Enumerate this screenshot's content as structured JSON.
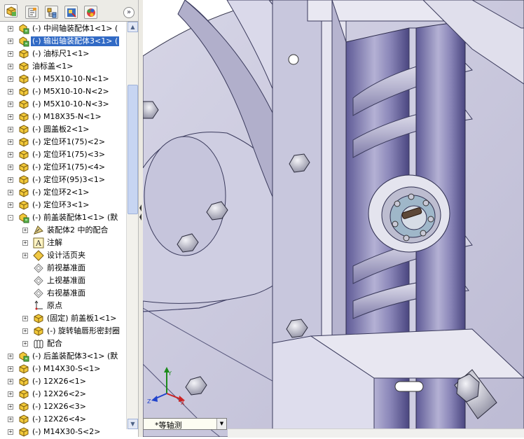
{
  "view_orientation": "*等轴测",
  "tree": [
    {
      "label": "(-) 中间轴装配体1<1> (",
      "expander": "+",
      "indent": 0,
      "icon": "assembly"
    },
    {
      "label": "(-) 输出轴装配体3<1> (",
      "expander": "+",
      "indent": 0,
      "icon": "assembly",
      "selected": true
    },
    {
      "label": "(-) 油标尺1<1>",
      "expander": "+",
      "indent": 0,
      "icon": "part"
    },
    {
      "label": "油标盖<1>",
      "expander": "+",
      "indent": 0,
      "icon": "part"
    },
    {
      "label": "(-) M5X10-10-N<1>",
      "expander": "+",
      "indent": 0,
      "icon": "part"
    },
    {
      "label": "(-) M5X10-10-N<2>",
      "expander": "+",
      "indent": 0,
      "icon": "part"
    },
    {
      "label": "(-) M5X10-10-N<3>",
      "expander": "+",
      "indent": 0,
      "icon": "part"
    },
    {
      "label": "(-) M18X35-N<1>",
      "expander": "+",
      "indent": 0,
      "icon": "part"
    },
    {
      "label": "(-) 圆盖板2<1>",
      "expander": "+",
      "indent": 0,
      "icon": "part"
    },
    {
      "label": "(-) 定位环1(75)<2>",
      "expander": "+",
      "indent": 0,
      "icon": "part"
    },
    {
      "label": "(-) 定位环1(75)<3>",
      "expander": "+",
      "indent": 0,
      "icon": "part"
    },
    {
      "label": "(-) 定位环1(75)<4>",
      "expander": "+",
      "indent": 0,
      "icon": "part"
    },
    {
      "label": "(-) 定位环(95)3<1>",
      "expander": "+",
      "indent": 0,
      "icon": "part"
    },
    {
      "label": "(-) 定位环2<1>",
      "expander": "+",
      "indent": 0,
      "icon": "part"
    },
    {
      "label": "(-) 定位环3<1>",
      "expander": "+",
      "indent": 0,
      "icon": "part"
    },
    {
      "label": "(-) 前盖装配体1<1> (默",
      "expander": "-",
      "indent": 0,
      "icon": "assembly"
    },
    {
      "label": "装配体2 中的配合",
      "expander": "+",
      "indent": 1,
      "icon": "mates-folder"
    },
    {
      "label": "注解",
      "expander": "+",
      "indent": 1,
      "icon": "annotation"
    },
    {
      "label": "设计活页夹",
      "expander": "+",
      "indent": 1,
      "icon": "binder"
    },
    {
      "label": "前视基准面",
      "expander": "",
      "indent": 1,
      "icon": "plane"
    },
    {
      "label": "上视基准面",
      "expander": "",
      "indent": 1,
      "icon": "plane"
    },
    {
      "label": "右视基准面",
      "expander": "",
      "indent": 1,
      "icon": "plane"
    },
    {
      "label": "原点",
      "expander": "",
      "indent": 1,
      "icon": "origin"
    },
    {
      "label": "(固定) 前盖板1<1>",
      "expander": "+",
      "indent": 1,
      "icon": "part"
    },
    {
      "label": "(-) 旋转轴唇形密封圈",
      "expander": "+",
      "indent": 1,
      "icon": "part"
    },
    {
      "label": "配合",
      "expander": "+",
      "indent": 1,
      "icon": "mates"
    },
    {
      "label": "(-) 后盖装配体3<1> (默",
      "expander": "+",
      "indent": 0,
      "icon": "assembly"
    },
    {
      "label": "(-) M14X30-S<1>",
      "expander": "+",
      "indent": 0,
      "icon": "part"
    },
    {
      "label": "(-) 12X26<1>",
      "expander": "+",
      "indent": 0,
      "icon": "part"
    },
    {
      "label": "(-) 12X26<2>",
      "expander": "+",
      "indent": 0,
      "icon": "part"
    },
    {
      "label": "(-) 12X26<3>",
      "expander": "+",
      "indent": 0,
      "icon": "part"
    },
    {
      "label": "(-) 12X26<4>",
      "expander": "+",
      "indent": 0,
      "icon": "part"
    },
    {
      "label": "(-) M14X30-S<2>",
      "expander": "+",
      "indent": 0,
      "icon": "part"
    }
  ],
  "tabs": [
    "feature-manager-icon",
    "property-manager-icon",
    "configuration-manager-icon",
    "dimxpert-icon",
    "display-manager-icon"
  ],
  "axes": {
    "x": "X",
    "y": "Y",
    "z": "Z"
  },
  "colors": {
    "selection": "#316ac5",
    "model_face": "#c9c8de",
    "model_shadow": "#6c68a0"
  }
}
